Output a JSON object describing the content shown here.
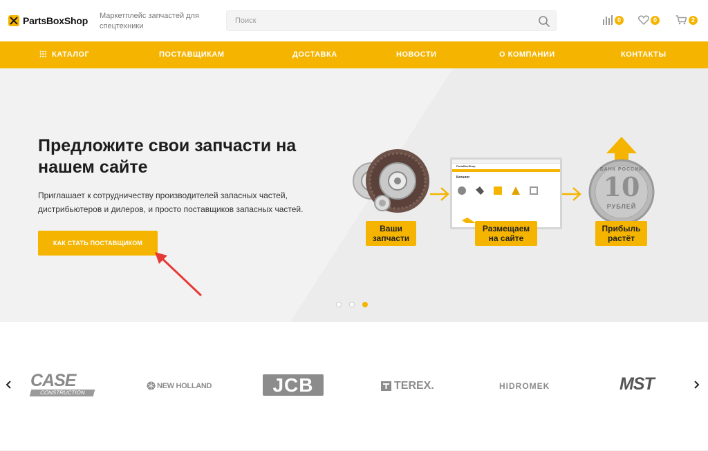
{
  "header": {
    "logo_text": "PartsBoxShop",
    "tagline": "Маркетплейс запчастей для спецтехники",
    "search_placeholder": "Поиск",
    "compare_count": "0",
    "favorites_count": "0",
    "cart_count": "2"
  },
  "nav": {
    "catalog": "Каталог",
    "suppliers": "Поставщикам",
    "delivery": "Доставка",
    "news": "Новости",
    "about": "О компании",
    "contacts": "Контакты"
  },
  "hero": {
    "title": "Предложите свои запчасти на нашем сайте",
    "text": "Приглашает к сотрудничеству производителей запасных частей, дистрибьютеров и дилеров, и просто поставщиков запасных частей.",
    "cta_label": "Как стать поставщиком",
    "steps": [
      {
        "line1": "Ваши",
        "line2": "запчасти"
      },
      {
        "line1": "Размещаем",
        "line2": "на сайте"
      },
      {
        "line1": "Прибыль",
        "line2": "растёт"
      }
    ],
    "coin": {
      "value": "10",
      "top_text": "БАНК РОССИИ",
      "bottom_text": "РУБЛЕЙ"
    },
    "mini_site": {
      "header": "PartsBoxShop",
      "heading": "Каталог"
    },
    "active_slide": 3,
    "slide_count": 3
  },
  "brands": {
    "items": [
      {
        "name": "CASE",
        "sub": "CONSTRUCTION"
      },
      {
        "name": "NEW HOLLAND"
      },
      {
        "name": "JCB"
      },
      {
        "name": "TEREX."
      },
      {
        "name": "HIDROMEK"
      },
      {
        "name": "MST"
      }
    ]
  },
  "colors": {
    "accent": "#f5b400",
    "hero_bg": "#f2f2f2",
    "arrow_red": "#e53935"
  }
}
